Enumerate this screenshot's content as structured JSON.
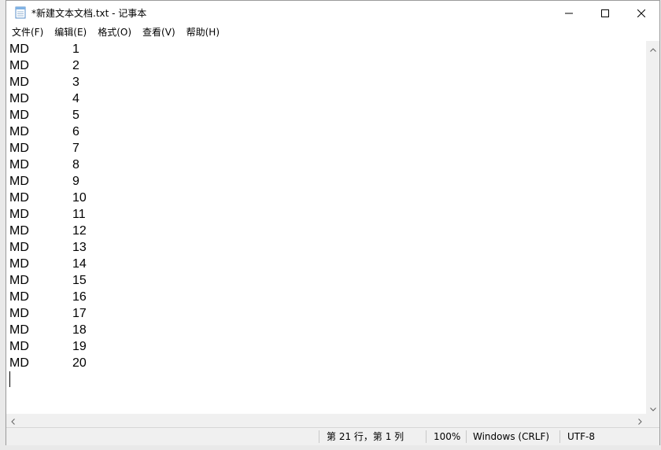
{
  "window": {
    "title": "*新建文本文档.txt - 记事本"
  },
  "menu": [
    {
      "label": "文件(F)"
    },
    {
      "label": "编辑(E)"
    },
    {
      "label": "格式(O)"
    },
    {
      "label": "查看(V)"
    },
    {
      "label": "帮助(H)"
    }
  ],
  "editor": {
    "lines": [
      {
        "prefix": "MD",
        "num": "1"
      },
      {
        "prefix": "MD",
        "num": "2"
      },
      {
        "prefix": "MD",
        "num": "3"
      },
      {
        "prefix": "MD",
        "num": "4"
      },
      {
        "prefix": "MD",
        "num": "5"
      },
      {
        "prefix": "MD",
        "num": "6"
      },
      {
        "prefix": "MD",
        "num": "7"
      },
      {
        "prefix": "MD",
        "num": "8"
      },
      {
        "prefix": "MD",
        "num": "9"
      },
      {
        "prefix": "MD",
        "num": "10"
      },
      {
        "prefix": "MD",
        "num": "11"
      },
      {
        "prefix": "MD",
        "num": "12"
      },
      {
        "prefix": "MD",
        "num": "13"
      },
      {
        "prefix": "MD",
        "num": "14"
      },
      {
        "prefix": "MD",
        "num": "15"
      },
      {
        "prefix": "MD",
        "num": "16"
      },
      {
        "prefix": "MD",
        "num": "17"
      },
      {
        "prefix": "MD",
        "num": "18"
      },
      {
        "prefix": "MD",
        "num": "19"
      },
      {
        "prefix": "MD",
        "num": "20"
      }
    ]
  },
  "status": {
    "position": "第 21 行，第 1 列",
    "zoom": "100%",
    "line_ending": "Windows (CRLF)",
    "encoding": "UTF-8"
  },
  "icons": {
    "app": "notepad-icon",
    "minimize": "minimize-icon",
    "maximize": "maximize-icon",
    "close": "close-icon"
  },
  "colors": {
    "window_bg": "#ffffff",
    "status_bg": "#f0f0f0",
    "text": "#000000"
  }
}
